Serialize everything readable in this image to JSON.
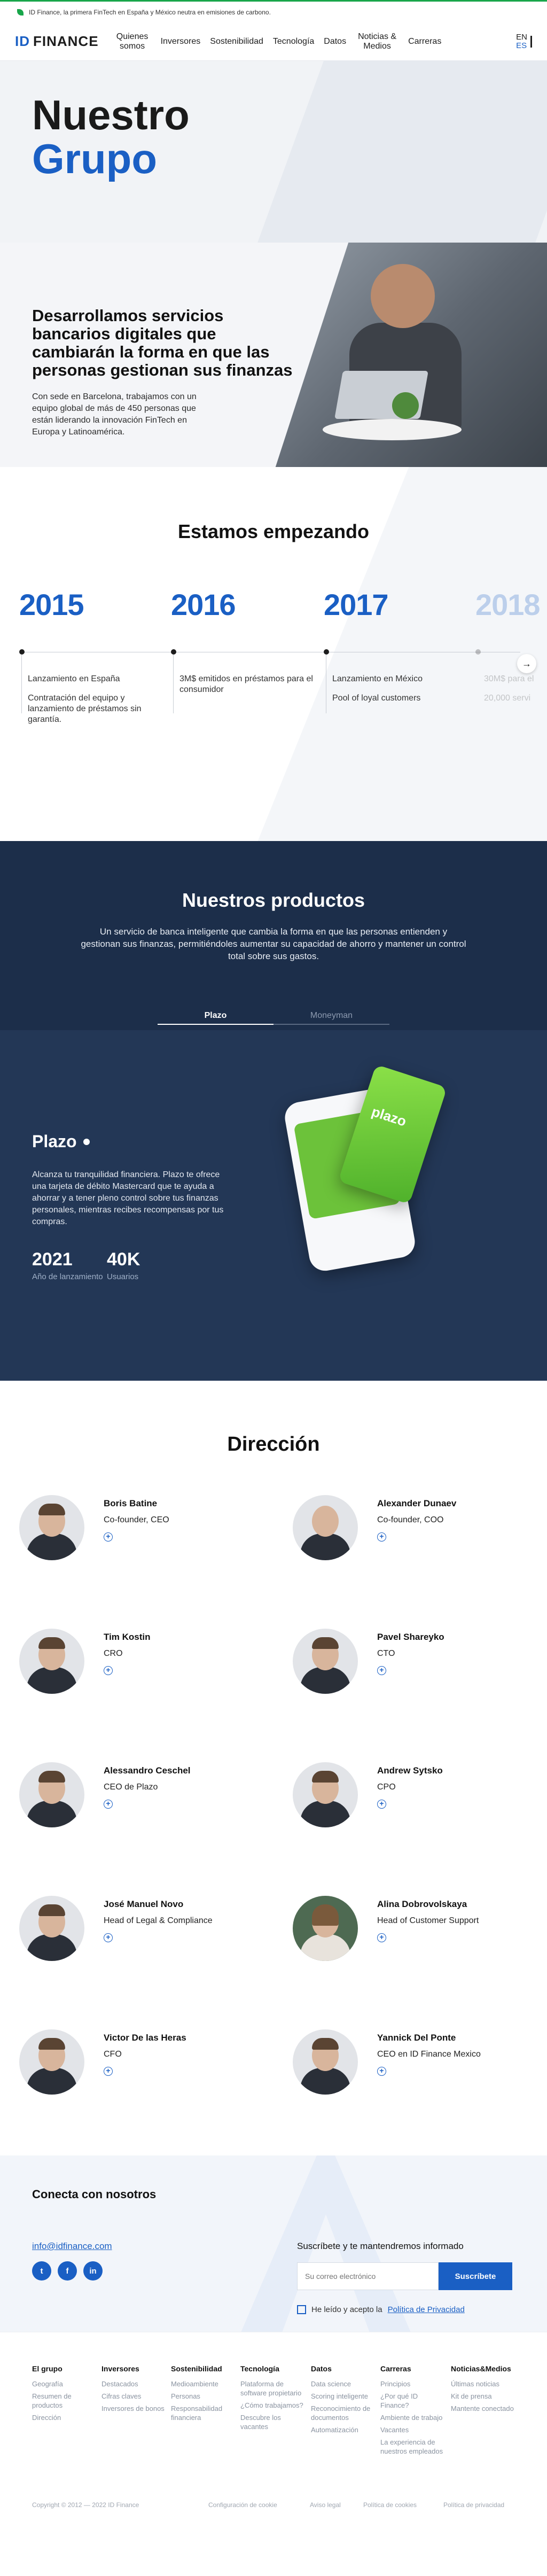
{
  "banner": {
    "text": "ID Finance, la primera FinTech en España y México neutra en emisiones de carbono."
  },
  "header": {
    "logo_id": "ID",
    "logo_text": "FINANCE",
    "nav": [
      "Quienes somos",
      "Inversores",
      "Sostenibilidad",
      "Tecnología",
      "Datos",
      "Noticias & Medios",
      "Carreras"
    ],
    "lang": {
      "en": "EN",
      "es": "ES"
    }
  },
  "hero": {
    "title_line1": "Nuestro",
    "title_line2": "Grupo"
  },
  "intro": {
    "heading": "Desarrollamos servicios bancarios digitales que cambiarán la forma en que las personas gestionan sus finanzas",
    "text": "Con sede en Barcelona, trabajamos con un equipo global de más de 450 personas que están liderando la innovación FinTech en Europa y Latinoamérica."
  },
  "timeline": {
    "title": "Estamos empezando",
    "items": [
      {
        "year": "2015",
        "lines": [
          "Lanzamiento en España",
          "Contratación del equipo y lanzamiento de préstamos sin garantía."
        ]
      },
      {
        "year": "2016",
        "lines": [
          "3M$ emitidos en préstamos para el consumidor"
        ]
      },
      {
        "year": "2017",
        "lines": [
          "Lanzamiento en México",
          "Pool of loyal customers"
        ]
      },
      {
        "year": "2018",
        "lines": [
          "30M$ para el",
          "20,000 servi"
        ]
      }
    ]
  },
  "products": {
    "title": "Nuestros productos",
    "subtitle": "Un servicio de banca inteligente que cambia la forma en que las personas entienden y gestionan sus finanzas, permitiéndoles aumentar su capacidad de ahorro y mantener un control total sobre sus gastos.",
    "tabs": [
      "Plazo",
      "Moneyman"
    ],
    "plazo": {
      "name": "Plazo",
      "description": "Alcanza tu tranquilidad financiera. Plazo te ofrece una tarjeta de débito Mastercard que te ayuda a ahorrar y a tener pleno control sobre tus finanzas personales, mientras recibes recompensas por tus compras.",
      "card_label": "plazo",
      "stats": [
        {
          "value": "2021",
          "label": "Año de lanzamiento"
        },
        {
          "value": "40K",
          "label": "Usuarios"
        }
      ]
    }
  },
  "direction": {
    "title": "Dirección",
    "people": [
      {
        "name": "Boris Batine",
        "role": "Co-founder, CEO"
      },
      {
        "name": "Alexander Dunaev",
        "role": "Co-founder, COO"
      },
      {
        "name": "Tim Kostin",
        "role": "CRO"
      },
      {
        "name": "Pavel Shareyko",
        "role": "CTO"
      },
      {
        "name": "Alessandro Ceschel",
        "role": "CEO de Plazo"
      },
      {
        "name": "Andrew Sytsko",
        "role": "CPO"
      },
      {
        "name": "José Manuel Novo",
        "role": "Head of Legal & Compliance"
      },
      {
        "name": "Alina Dobrovolskaya",
        "role": "Head of Customer Support"
      },
      {
        "name": "Victor De las Heras",
        "role": "CFO"
      },
      {
        "name": "Yannick Del Ponte",
        "role": "CEO en ID Finance Mexico"
      }
    ]
  },
  "connect": {
    "title": "Conecta con nosotros",
    "email": "info@idfinance.com",
    "social": [
      "t",
      "f",
      "in"
    ],
    "subscribe_label": "Suscríbete y te mantendremos informado",
    "email_placeholder": "Su correo electrónico",
    "subscribe_button": "Suscríbete",
    "consent_text": "He leído y acepto la",
    "privacy_link": "Política de Privacidad"
  },
  "footer": {
    "columns": [
      {
        "title": "El grupo",
        "links": [
          "Geografía",
          "Resumen de productos",
          "Dirección"
        ]
      },
      {
        "title": "Inversores",
        "links": [
          "Destacados",
          "Cifras claves",
          "Inversores de bonos"
        ]
      },
      {
        "title": "Sostenibilidad",
        "links": [
          "Medioambiente",
          "Personas",
          "Responsabilidad financiera"
        ]
      },
      {
        "title": "Tecnología",
        "links": [
          "Plataforma de software propietario",
          "¿Cómo trabajamos?",
          "Descubre los vacantes"
        ]
      },
      {
        "title": "Datos",
        "links": [
          "Data science",
          "Scoring inteligente",
          "Reconocimiento de documentos",
          "Automatización"
        ]
      },
      {
        "title": "Carreras",
        "links": [
          "Principios",
          "¿Por qué ID Finance?",
          "Ambiente de trabajo",
          "Vacantes",
          "La experiencia de nuestros empleados"
        ]
      },
      {
        "title": "Noticias&Medios",
        "links": [
          "Últimas noticias",
          "Kit de prensa",
          "Mantente conectado"
        ]
      }
    ],
    "copyright": "Copyright © 2012 — 2022 ID Finance",
    "bottom_links": [
      "Configuración de cookie",
      "Aviso legal",
      "Política de cookies",
      "Política de privacidad"
    ]
  }
}
